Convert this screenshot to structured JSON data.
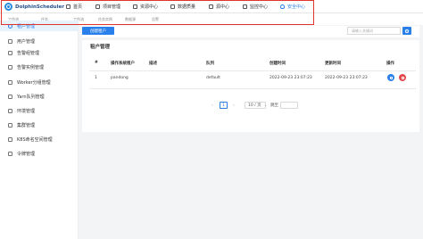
{
  "header": {
    "brand": "DolphinScheduler",
    "nav": [
      {
        "label": "首页",
        "icon": "home-icon"
      },
      {
        "label": "项目管理",
        "icon": "project-icon"
      },
      {
        "label": "资源中心",
        "icon": "folder-icon"
      },
      {
        "label": "数据质量",
        "icon": "data-quality-icon"
      },
      {
        "label": "源中心",
        "icon": "datasource-icon"
      },
      {
        "label": "监控中心",
        "icon": "monitor-icon"
      },
      {
        "label": "安全中心",
        "icon": "shield-icon",
        "active": true
      }
    ],
    "accent_color": "#2a80eb",
    "highlight_color": "#e0342e"
  },
  "subtabs": [
    "工作流",
    "任务",
    "工作流",
    "任务实例",
    "数据源",
    "告警"
  ],
  "sidebar": {
    "items": [
      {
        "label": "租户管理",
        "active": true
      },
      {
        "label": "用户管理"
      },
      {
        "label": "告警组管理"
      },
      {
        "label": "告警实例管理"
      },
      {
        "label": "Worker分组管理"
      },
      {
        "label": "Yarn队列管理"
      },
      {
        "label": "环境管理"
      },
      {
        "label": "集群管理"
      },
      {
        "label": "K8S命名空间管理"
      },
      {
        "label": "令牌管理"
      }
    ]
  },
  "toolbar": {
    "create_label": "创建租户",
    "search_placeholder": "请输入关键词"
  },
  "table": {
    "title": "租户管理",
    "columns": [
      "#",
      "操作系统租户",
      "描述",
      "队列",
      "创建时间",
      "更新时间",
      "操作"
    ],
    "rows": [
      {
        "index": "1",
        "tenant": "pandong",
        "description": "",
        "queue": "default",
        "created": "2022-09-23 23:07:23",
        "updated": "2022-09-23 23:07:23"
      }
    ]
  },
  "pagination": {
    "prev": "‹",
    "page": "1",
    "next": "›",
    "page_size": "10 / 页",
    "jump_label": "跳至"
  }
}
